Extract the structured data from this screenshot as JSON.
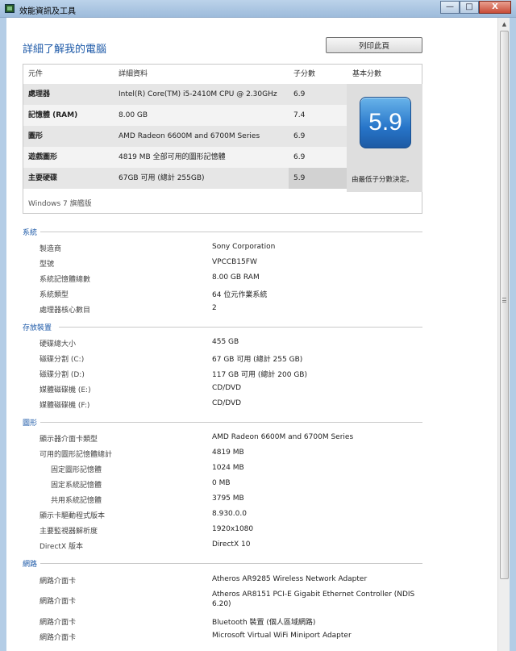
{
  "window": {
    "title": "效能資訊及工具",
    "minimize": "—",
    "maximize": "□",
    "close": "X"
  },
  "page": {
    "title": "詳細了解我的電腦",
    "print_label": "列印此頁"
  },
  "scores": {
    "headers": {
      "component": "元件",
      "details": "詳細資料",
      "subscore": "子分數",
      "base": "基本分數"
    },
    "rows": [
      {
        "component": "處理器",
        "details": "Intel(R) Core(TM) i5-2410M CPU @ 2.30GHz",
        "subscore": "6.9"
      },
      {
        "component": "記憶體 (RAM)",
        "details": "8.00 GB",
        "subscore": "7.4"
      },
      {
        "component": "圖形",
        "details": "AMD Radeon 6600M and 6700M Series",
        "subscore": "6.9"
      },
      {
        "component": "遊戲圖形",
        "details": "4819 MB 全部可用的圖形記憶體",
        "subscore": "6.9"
      },
      {
        "component": "主要硬碟",
        "details": "67GB 可用 (總計 255GB)",
        "subscore": "5.9"
      }
    ],
    "base_score": "5.9",
    "base_note": "由最低子分數決定。",
    "edition": "Windows 7 旗艦版"
  },
  "sections": {
    "system": {
      "title": "系統",
      "rows": [
        {
          "label": "製造商",
          "value": "Sony Corporation"
        },
        {
          "label": "型號",
          "value": "VPCCB15FW"
        },
        {
          "label": "系統記憶體總數",
          "value": "8.00 GB RAM"
        },
        {
          "label": "系統類型",
          "value": "64 位元作業系統"
        },
        {
          "label": "處理器核心數目",
          "value": "2"
        }
      ]
    },
    "storage": {
      "title": "存放裝置",
      "rows": [
        {
          "label": "硬碟總大小",
          "value": "455 GB"
        },
        {
          "label": "磁碟分割 (C:)",
          "value": "67 GB 可用 (總計 255 GB)"
        },
        {
          "label": "磁碟分割 (D:)",
          "value": "117 GB 可用 (總計 200 GB)"
        },
        {
          "label": "媒體磁碟機 (E:)",
          "value": "CD/DVD"
        },
        {
          "label": "媒體磁碟機 (F:)",
          "value": "CD/DVD"
        }
      ]
    },
    "graphics": {
      "title": "圖形",
      "rows": [
        {
          "label": "顯示器介面卡類型",
          "value": "AMD Radeon 6600M and 6700M Series"
        },
        {
          "label": "可用的圖形記憶體總計",
          "value": "4819 MB"
        },
        {
          "label": "固定圖形記憶體",
          "value": "1024 MB"
        },
        {
          "label": "固定系統記憶體",
          "value": "0 MB"
        },
        {
          "label": "共用系統記憶體",
          "value": "3795 MB"
        },
        {
          "label": "顯示卡驅動程式版本",
          "value": "8.930.0.0"
        },
        {
          "label": "主要監視器解析度",
          "value": "1920x1080"
        },
        {
          "label": "DirectX 版本",
          "value": "DirectX 10"
        }
      ]
    },
    "network": {
      "title": "網路",
      "rows": [
        {
          "label": "網路介面卡",
          "value": "Atheros AR9285 Wireless Network Adapter"
        },
        {
          "label": "網路介面卡",
          "value": "Atheros AR8151 PCI-E Gigabit Ethernet Controller (NDIS",
          "value2": "6.20)"
        },
        {
          "label": "網路介面卡",
          "value": "Bluetooth 裝置 (個人區域網路)"
        },
        {
          "label": "網路介面卡",
          "value": "Microsoft Virtual WiFi Miniport Adapter"
        }
      ]
    }
  }
}
